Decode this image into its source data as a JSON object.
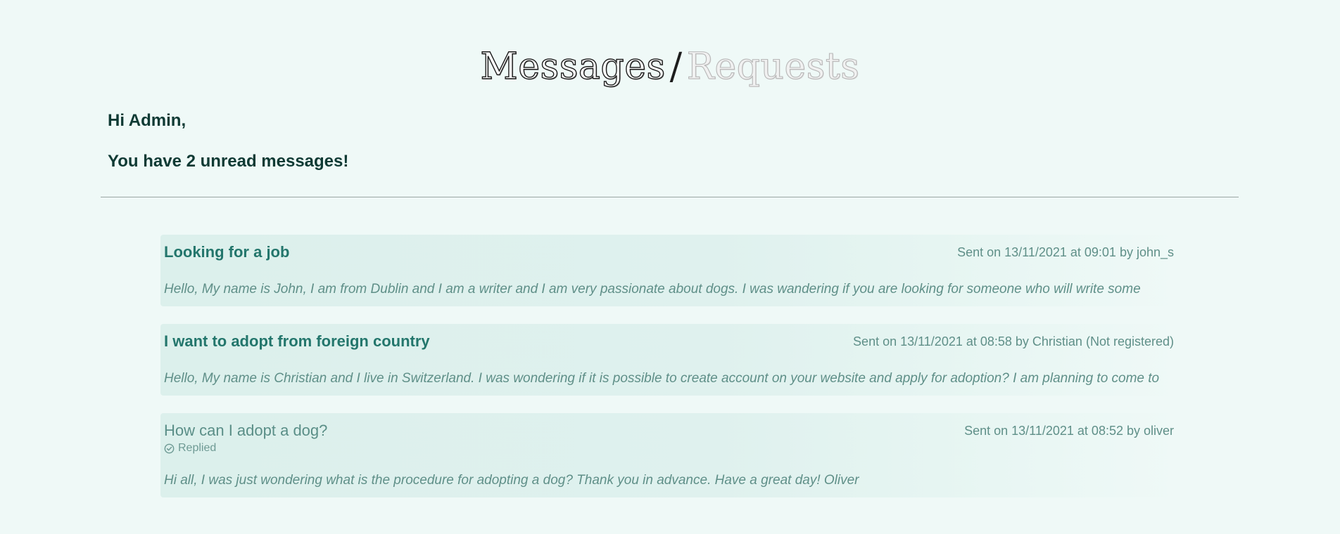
{
  "header": {
    "active_tab": "Messages",
    "separator": "/",
    "inactive_tab": "Requests"
  },
  "greeting": {
    "hello": "Hi Admin,",
    "unread_text": "You have 2 unread messages!"
  },
  "messages": [
    {
      "subject": "Looking for a job",
      "meta": "Sent on 13/11/2021 at 09:01 by john_s",
      "body": "Hello, My name is John, I am from Dublin and I am a writer and I am very passionate about dogs. I was wandering if you are looking for someone who will write some",
      "unread": true
    },
    {
      "subject": "I want to adopt from foreign country",
      "meta": "Sent on 13/11/2021 at 08:58 by Christian (Not registered)",
      "body": "Hello, My name is Christian and I live in Switzerland. I was wondering if it is possible to create account on your website and apply for adoption? I am planning to come to",
      "unread": true
    },
    {
      "subject": "How can I adopt a dog?",
      "meta": "Sent on 13/11/2021 at 08:52 by oliver",
      "status": "Replied",
      "status_icon": "check-circle-icon",
      "body": "Hi all, I was just wondering what is the procedure for adopting a dog? Thank you in advance. Have a great day! Oliver",
      "unread": false
    }
  ],
  "colors": {
    "background": "#eff9f7",
    "card": "#dcf0ec",
    "unread_subject": "#23766c",
    "meta_text": "#5f8f88",
    "heading_text": "#0f3a34"
  }
}
